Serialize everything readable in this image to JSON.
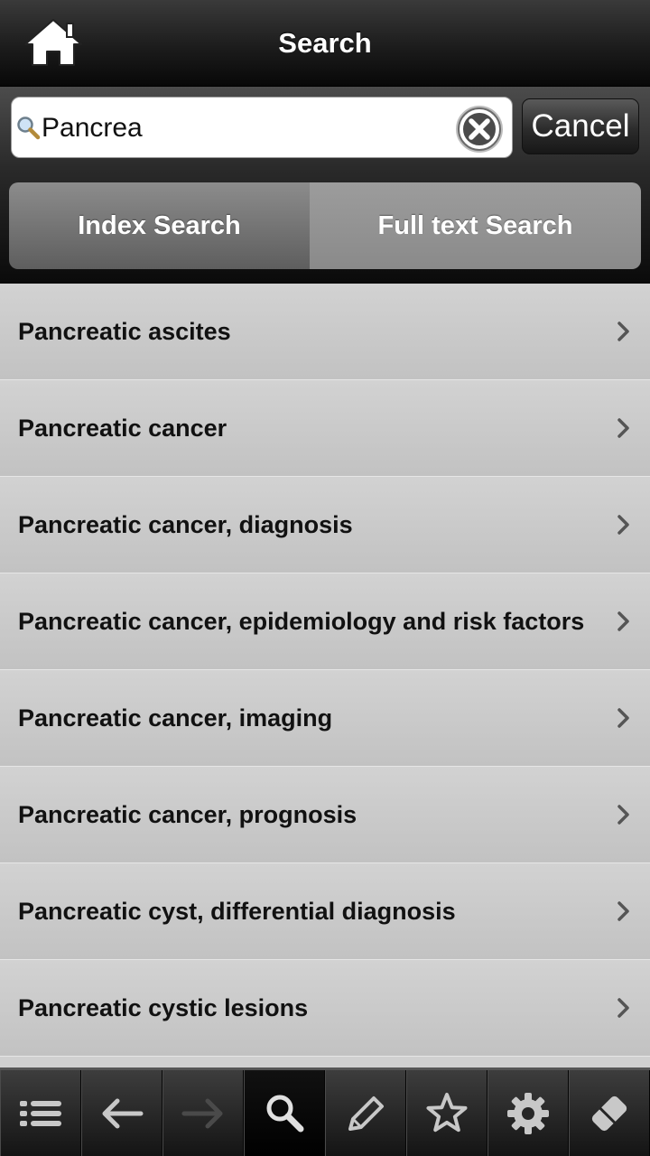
{
  "header": {
    "title": "Search",
    "home_icon": "home-icon"
  },
  "search": {
    "value": "Pancrea",
    "placeholder": "",
    "cancel_label": "Cancel"
  },
  "tabs": [
    {
      "label": "Index Search",
      "active": true
    },
    {
      "label": "Full text Search",
      "active": false
    }
  ],
  "results": [
    {
      "label": "Pancreatic ascites"
    },
    {
      "label": "Pancreatic cancer"
    },
    {
      "label": "Pancreatic cancer, diagnosis"
    },
    {
      "label": "Pancreatic cancer, epidemiology and risk factors"
    },
    {
      "label": "Pancreatic cancer, imaging"
    },
    {
      "label": "Pancreatic cancer, prognosis"
    },
    {
      "label": "Pancreatic cyst, differential diagnosis"
    },
    {
      "label": "Pancreatic cystic lesions"
    }
  ],
  "toolbar": {
    "items": [
      {
        "icon": "list-icon"
      },
      {
        "icon": "back-arrow-icon"
      },
      {
        "icon": "forward-arrow-icon",
        "disabled": true
      },
      {
        "icon": "search-icon",
        "active": true
      },
      {
        "icon": "pencil-icon"
      },
      {
        "icon": "star-icon"
      },
      {
        "icon": "gear-icon"
      },
      {
        "icon": "eraser-icon"
      }
    ]
  },
  "colors": {
    "header_bg": "#1c1c1c",
    "list_bg": "#c8c8c8",
    "active_tab": "#6e6e6e",
    "inactive_tab": "#919191"
  }
}
